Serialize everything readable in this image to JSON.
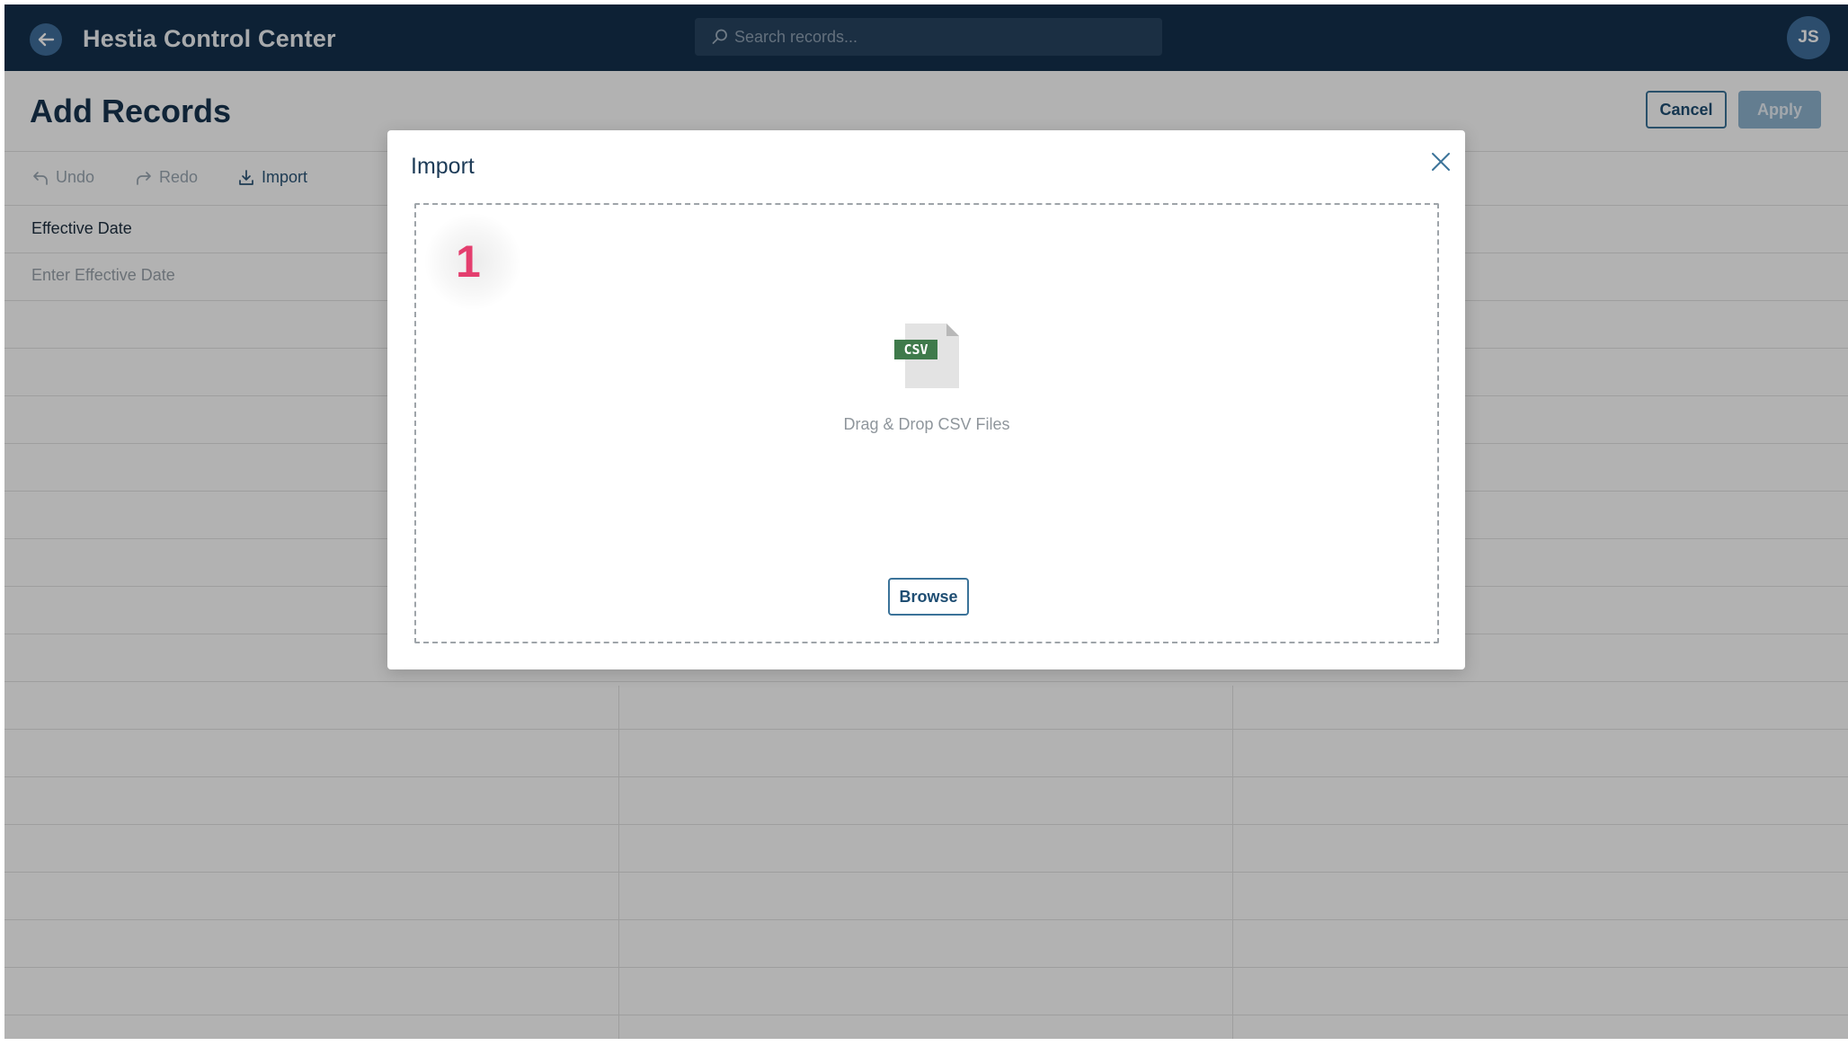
{
  "header": {
    "app_title": "Hestia Control Center",
    "search_placeholder": "Search records...",
    "avatar_initials": "JS"
  },
  "page": {
    "title": "Add Records",
    "cancel_label": "Cancel",
    "apply_label": "Apply"
  },
  "toolbar": {
    "undo_label": "Undo",
    "redo_label": "Redo",
    "import_label": "Import"
  },
  "grid": {
    "column_header": "Effective Date",
    "cell_placeholder": "Enter Effective Date"
  },
  "modal": {
    "title": "Import",
    "step_number": "1",
    "csv_badge": "CSV",
    "drop_label": "Drag & Drop CSV Files",
    "browse_label": "Browse"
  },
  "colors": {
    "header_bg": "#13304c",
    "accent": "#3b7399",
    "step_marker": "#e43e6e",
    "csv_badge": "#3f7a4b"
  }
}
